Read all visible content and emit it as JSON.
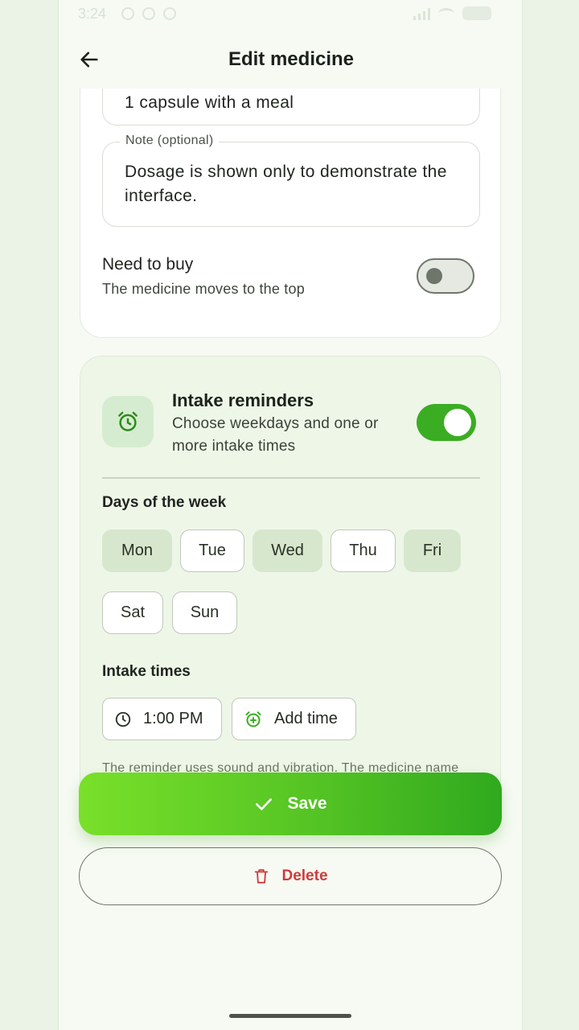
{
  "status_bar": {
    "time": "3:24"
  },
  "app_bar": {
    "title": "Edit medicine"
  },
  "dose_field": {
    "value": "1 capsule with a meal"
  },
  "note_field": {
    "label": "Note (optional)",
    "value": "Dosage is shown only to demonstrate the interface."
  },
  "need_to_buy": {
    "title": "Need to buy",
    "subtitle": "The medicine moves to the top",
    "enabled": false
  },
  "reminders": {
    "title": "Intake reminders",
    "subtitle": "Choose weekdays and one or more intake times",
    "enabled": true,
    "days_label": "Days of the week",
    "days": [
      {
        "label": "Mon",
        "selected": true
      },
      {
        "label": "Tue",
        "selected": false
      },
      {
        "label": "Wed",
        "selected": true
      },
      {
        "label": "Thu",
        "selected": false
      },
      {
        "label": "Fri",
        "selected": true
      },
      {
        "label": "Sat",
        "selected": false
      },
      {
        "label": "Sun",
        "selected": false
      }
    ],
    "times_label": "Intake times",
    "times": [
      "1:00 PM"
    ],
    "add_time_label": "Add time",
    "note": "The reminder uses sound and vibration. The medicine name and dose may appear on the lock screen depending on your phone settings."
  },
  "actions": {
    "save_label": "Save",
    "delete_label": "Delete"
  },
  "colors": {
    "accent": "#3aad22",
    "danger": "#cf3b3b",
    "chip_selected": "#d7e7cd"
  }
}
